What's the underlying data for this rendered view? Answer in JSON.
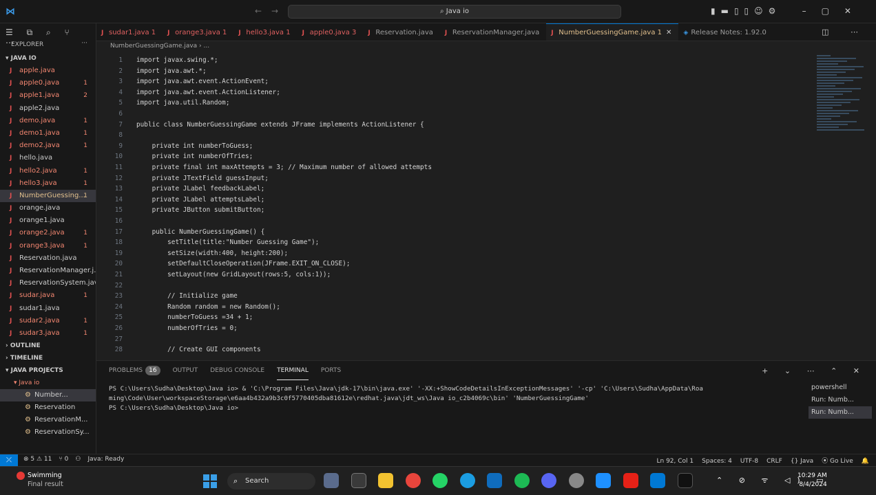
{
  "window": {
    "search_text": "Java io",
    "nav_arrows": "←→",
    "title_icons": "▮▬▯▯☺⚙",
    "window_controls": "–▢✕"
  },
  "explorer": {
    "top_icons": "☰ ⧉ ⌕ ⑂ ⋯",
    "title": "EXPLORER",
    "more": "···",
    "root": "▾ JAVA IO",
    "files": [
      {
        "name": "apple.java",
        "badge": "",
        "state": "err"
      },
      {
        "name": "apple0.java",
        "badge": "1",
        "state": "err"
      },
      {
        "name": "apple1.java",
        "badge": "2",
        "state": "err"
      },
      {
        "name": "apple2.java",
        "badge": "",
        "state": "clean"
      },
      {
        "name": "demo.java",
        "badge": "1",
        "state": "err"
      },
      {
        "name": "demo1.java",
        "badge": "1",
        "state": "err"
      },
      {
        "name": "demo2.java",
        "badge": "1",
        "state": "err"
      },
      {
        "name": "hello.java",
        "badge": "",
        "state": "clean"
      },
      {
        "name": "hello2.java",
        "badge": "1",
        "state": "err"
      },
      {
        "name": "hello3.java",
        "badge": "1",
        "state": "err"
      },
      {
        "name": "NumberGuessing...",
        "badge": "1",
        "state": "mod"
      },
      {
        "name": "orange.java",
        "badge": "",
        "state": "clean"
      },
      {
        "name": "orange1.java",
        "badge": "",
        "state": "clean"
      },
      {
        "name": "orange2.java",
        "badge": "1",
        "state": "err"
      },
      {
        "name": "orange3.java",
        "badge": "1",
        "state": "err"
      },
      {
        "name": "Reservation.java",
        "badge": "",
        "state": "clean"
      },
      {
        "name": "ReservationManager.j...",
        "badge": "",
        "state": "clean"
      },
      {
        "name": "ReservationSystem.java",
        "badge": "",
        "state": "clean"
      },
      {
        "name": "sudar.java",
        "badge": "1",
        "state": "err"
      },
      {
        "name": "sudar1.java",
        "badge": "",
        "state": "clean"
      },
      {
        "name": "sudar2.java",
        "badge": "1",
        "state": "err"
      },
      {
        "name": "sudar3.java",
        "badge": "1",
        "state": "err"
      }
    ],
    "outline": "› OUTLINE",
    "timeline": "› TIMELINE",
    "java_projects": "▾ JAVA PROJECTS",
    "project": "▾ Java io",
    "project_items": [
      "Number...",
      "Reservation",
      "ReservationM...",
      "ReservationSy..."
    ]
  },
  "tabs": [
    {
      "label": "sudar1.java 1",
      "kind": "err"
    },
    {
      "label": "orange3.java 1",
      "kind": "err"
    },
    {
      "label": "hello3.java 1",
      "kind": "err"
    },
    {
      "label": "apple0.java 3",
      "kind": "err"
    },
    {
      "label": "Reservation.java",
      "kind": "plain"
    },
    {
      "label": "ReservationManager.java",
      "kind": "plain"
    },
    {
      "label": "NumberGuessingGame.java 1",
      "kind": "active"
    },
    {
      "label": "Release Notes: 1.92.0",
      "kind": "info"
    }
  ],
  "tab_close": "✕",
  "tab_actions": "◫ ⋯",
  "breadcrumb": "NumberGuessingGame.java › ...",
  "code": [
    {
      "n": "1",
      "t": "import javax.swing.*;"
    },
    {
      "n": "2",
      "t": "import java.awt.*;"
    },
    {
      "n": "3",
      "t": "import java.awt.event.ActionEvent;"
    },
    {
      "n": "4",
      "t": "import java.awt.event.ActionListener;"
    },
    {
      "n": "5",
      "t": "import java.util.Random;"
    },
    {
      "n": "6",
      "t": ""
    },
    {
      "n": "7",
      "t": "public class NumberGuessingGame extends JFrame implements ActionListener {"
    },
    {
      "n": "8",
      "t": ""
    },
    {
      "n": "9",
      "t": "    private int numberToGuess;"
    },
    {
      "n": "10",
      "t": "    private int numberOfTries;"
    },
    {
      "n": "11",
      "t": "    private final int maxAttempts = 3; // Maximum number of allowed attempts"
    },
    {
      "n": "12",
      "t": "    private JTextField guessInput;"
    },
    {
      "n": "13",
      "t": "    private JLabel feedbackLabel;"
    },
    {
      "n": "14",
      "t": "    private JLabel attemptsLabel;"
    },
    {
      "n": "15",
      "t": "    private JButton submitButton;"
    },
    {
      "n": "16",
      "t": ""
    },
    {
      "n": "17",
      "t": "    public NumberGuessingGame() {"
    },
    {
      "n": "18",
      "t": "        setTitle(title:\"Number Guessing Game\");"
    },
    {
      "n": "19",
      "t": "        setSize(width:400, height:200);"
    },
    {
      "n": "20",
      "t": "        setDefaultCloseOperation(JFrame.EXIT_ON_CLOSE);"
    },
    {
      "n": "21",
      "t": "        setLayout(new GridLayout(rows:5, cols:1));"
    },
    {
      "n": "22",
      "t": ""
    },
    {
      "n": "23",
      "t": "        // Initialize game"
    },
    {
      "n": "24",
      "t": "        Random random = new Random();"
    },
    {
      "n": "25",
      "t": "        numberToGuess =34 + 1;"
    },
    {
      "n": "26",
      "t": "        numberOfTries = 0;"
    },
    {
      "n": "27",
      "t": ""
    },
    {
      "n": "28",
      "t": "        // Create GUI components"
    }
  ],
  "panel": {
    "tabs": [
      {
        "label": "PROBLEMS",
        "count": "16"
      },
      {
        "label": "OUTPUT",
        "count": ""
      },
      {
        "label": "DEBUG CONSOLE",
        "count": ""
      },
      {
        "label": "TERMINAL",
        "count": ""
      },
      {
        "label": "PORTS",
        "count": ""
      }
    ],
    "actions": "+ ⌄ ⋯ ⌃ ✕",
    "terminal": [
      "PS C:\\Users\\Sudha\\Desktop\\Java io>  & 'C:\\Program Files\\Java\\jdk-17\\bin\\java.exe' '-XX:+ShowCodeDetailsInExceptionMessages' '-cp' 'C:\\Users\\Sudha\\AppData\\Roa",
      "ming\\Code\\User\\workspaceStorage\\e6aa4b432a9b3c0f5770405dba81612e\\redhat.java\\jdt_ws\\Java io_c2b4069c\\bin' 'NumberGuessingGame'",
      "PS C:\\Users\\Sudha\\Desktop\\Java io> "
    ],
    "terminal_list": [
      "powershell",
      "Run: Numb...",
      "Run: Numb..."
    ]
  },
  "statusbar": {
    "remote": "⤫",
    "left": [
      "⊗ 5 ⚠ 11",
      "⑂ 0",
      "⚇",
      "Java: Ready"
    ],
    "right": [
      "Ln 92, Col 1",
      "Spaces: 4",
      "UTF-8",
      "CRLF",
      "{} Java",
      "⦿ Go Live",
      "🔔"
    ]
  },
  "taskbar": {
    "weather_title": "Swimming",
    "weather_sub": "Final result",
    "search": "Search",
    "tray": "⌃ ⊘ ᯤ ◁) ▭",
    "time": "10:29 AM",
    "date": "8/4/2024"
  },
  "colors": {
    "accent": "#0078d4",
    "error_file": "#f48771",
    "modified_file": "#e2c08d"
  }
}
